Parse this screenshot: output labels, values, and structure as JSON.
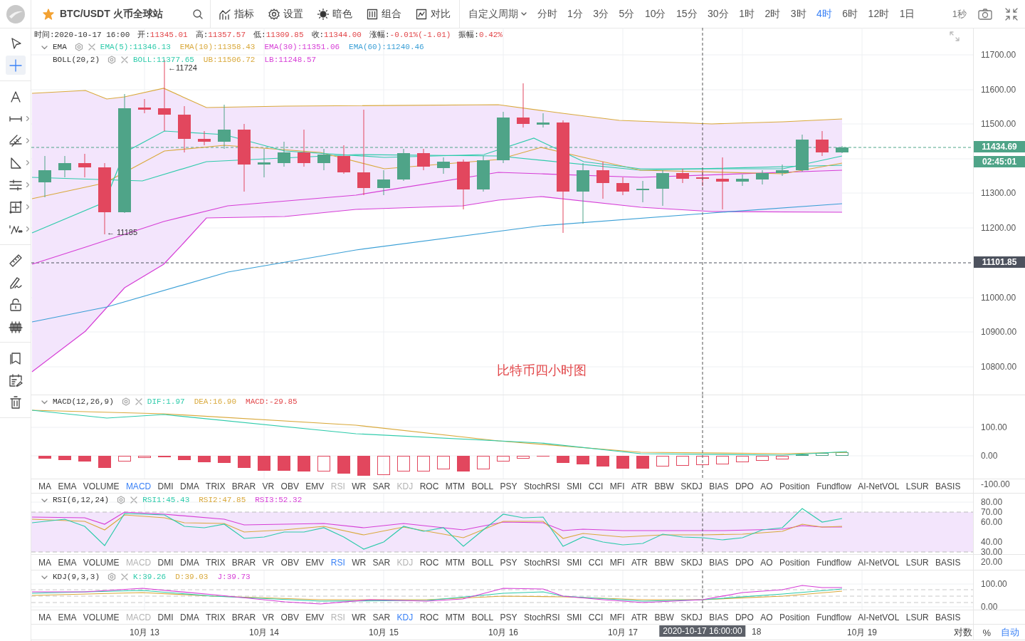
{
  "top_bar": {
    "symbol": "BTC/USDT 火币全球站",
    "favorite": true,
    "menus": [
      {
        "kind": "indicators",
        "label": "指标"
      },
      {
        "kind": "settings",
        "label": "设置"
      },
      {
        "kind": "theme",
        "label": "暗色"
      },
      {
        "kind": "layout",
        "label": "组合"
      },
      {
        "kind": "compare",
        "label": "对比"
      }
    ],
    "custom_period": "自定义周期",
    "periods": [
      {
        "label": "分时",
        "selected": false
      },
      {
        "label": "1分",
        "selected": false
      },
      {
        "label": "3分",
        "selected": false
      },
      {
        "label": "5分",
        "selected": false
      },
      {
        "label": "10分",
        "selected": false
      },
      {
        "label": "15分",
        "selected": false
      },
      {
        "label": "30分",
        "selected": false
      },
      {
        "label": "1时",
        "selected": false
      },
      {
        "label": "2时",
        "selected": false
      },
      {
        "label": "3时",
        "selected": false
      },
      {
        "label": "4时",
        "selected": true
      },
      {
        "label": "6时",
        "selected": false
      },
      {
        "label": "12时",
        "selected": false
      },
      {
        "label": "1日",
        "selected": false
      }
    ],
    "refresh": "1秒"
  },
  "drawing_tools": [
    [
      {
        "kind": "cursor",
        "selected": false,
        "submenu": false
      },
      {
        "kind": "crosshair",
        "selected": true,
        "submenu": false
      }
    ],
    [
      {
        "kind": "text",
        "selected": false,
        "submenu": false
      },
      {
        "kind": "segment",
        "selected": false,
        "submenu": true
      },
      {
        "kind": "channel",
        "selected": false,
        "submenu": true
      },
      {
        "kind": "triangle",
        "selected": false,
        "submenu": true
      },
      {
        "kind": "levels",
        "selected": false,
        "submenu": true
      },
      {
        "kind": "frame",
        "selected": false,
        "submenu": true
      },
      {
        "kind": "wave",
        "selected": false,
        "submenu": true
      }
    ],
    [
      {
        "kind": "ruler",
        "selected": false,
        "submenu": false
      },
      {
        "kind": "pen",
        "selected": false,
        "submenu": false
      },
      {
        "kind": "lock",
        "selected": false,
        "submenu": false
      },
      {
        "kind": "candles",
        "selected": false,
        "submenu": false
      }
    ],
    [
      {
        "kind": "bookmark",
        "selected": false,
        "submenu": false
      },
      {
        "kind": "calendar",
        "selected": false,
        "submenu": false
      },
      {
        "kind": "trash",
        "selected": false,
        "submenu": false
      }
    ]
  ],
  "main_pane": {
    "info": [
      {
        "label": "时间:",
        "value": "2020-10-17 16:00"
      },
      {
        "label": "开:",
        "value": "11345.01",
        "color": "#e2474a"
      },
      {
        "label": "高:",
        "value": "11357.57",
        "color": "#e2474a"
      },
      {
        "label": "低:",
        "value": "11309.85",
        "color": "#e2474a"
      },
      {
        "label": "收:",
        "value": "11344.00",
        "color": "#e2474a"
      },
      {
        "label": "涨幅:",
        "value": "-0.01%(-1.01)",
        "color": "#e2474a"
      },
      {
        "label": "振幅:",
        "value": "0.42%",
        "color": "#e2474a"
      }
    ],
    "legends": [
      {
        "name": "EMA",
        "expanded": true,
        "values": [
          {
            "text": "EMA(5):11346.13",
            "color": "#2ecbab"
          },
          {
            "text": "EMA(10):11358.43",
            "color": "#d9a93c"
          },
          {
            "text": "EMA(30):11351.06",
            "color": "#d63ed6"
          },
          {
            "text": "EMA(60):11240.46",
            "color": "#3a9fd6"
          }
        ]
      },
      {
        "name": "BOLL(20,2)",
        "values": [
          {
            "text": "BOLL:11377.65",
            "color": "#2ecbab"
          },
          {
            "text": "UB:11506.72",
            "color": "#d9a93c"
          },
          {
            "text": "LB:11248.57",
            "color": "#d63ed6"
          }
        ]
      }
    ],
    "high_marker": "←11724",
    "low_marker": "← 11185",
    "note": "比特币四小时图",
    "axis_labels": [
      "11700.00",
      "11600.00",
      "11500.00",
      "11300.00",
      "11200.00",
      "11000.00",
      "10900.00",
      "10800.00"
    ],
    "price_labels": [
      {
        "text": "11434.69",
        "color": "#4fa488"
      },
      {
        "text": "02:45:01",
        "color": "#4fa488"
      },
      {
        "text": "11101.85",
        "color": "#4d525e"
      }
    ]
  },
  "macd_pane": {
    "legend": {
      "name": "MACD(12,26,9)",
      "expanded": true,
      "values": [
        {
          "text": "DIF:1.97",
          "color": "#2ecbab"
        },
        {
          "text": "DEA:16.90",
          "color": "#d9a93c"
        },
        {
          "text": "MACD:-29.85",
          "color": "#e2474a"
        }
      ]
    },
    "axis_labels": [
      "100.00",
      "0.00",
      "-100.00"
    ]
  },
  "rsi_pane": {
    "legend": {
      "name": "RSI(6,12,24)",
      "expanded": true,
      "values": [
        {
          "text": "RSI1:45.43",
          "color": "#2ecbab"
        },
        {
          "text": "RSI2:47.85",
          "color": "#d9a93c"
        },
        {
          "text": "RSI3:52.32",
          "color": "#d63ed6"
        }
      ]
    },
    "axis_labels": [
      "80.00",
      "70.00",
      "60.00",
      "40.00",
      "30.00",
      "20.00"
    ]
  },
  "kdj_pane": {
    "legend": {
      "name": "KDJ(9,3,3)",
      "expanded": true,
      "values": [
        {
          "text": "K:39.26",
          "color": "#2ecbab"
        },
        {
          "text": "D:39.03",
          "color": "#d9a93c"
        },
        {
          "text": "J:39.73",
          "color": "#d63ed6"
        }
      ]
    },
    "axis_labels": [
      "100.00",
      "0.00"
    ]
  },
  "indicator_tab_rows": [
    [
      {
        "label": "MA",
        "selected": false,
        "disabled": false
      },
      {
        "label": "EMA",
        "selected": false,
        "disabled": false
      },
      {
        "label": "VOLUME",
        "selected": false,
        "disabled": false
      },
      {
        "label": "MACD",
        "selected": true,
        "disabled": false
      },
      {
        "label": "DMI",
        "selected": false,
        "disabled": false
      },
      {
        "label": "DMA",
        "selected": false,
        "disabled": false
      },
      {
        "label": "TRIX",
        "selected": false,
        "disabled": false
      },
      {
        "label": "BRAR",
        "selected": false,
        "disabled": false
      },
      {
        "label": "VR",
        "selected": false,
        "disabled": false
      },
      {
        "label": "OBV",
        "selected": false,
        "disabled": false
      },
      {
        "label": "EMV",
        "selected": false,
        "disabled": false
      },
      {
        "label": "RSI",
        "selected": false,
        "disabled": true
      },
      {
        "label": "WR",
        "selected": false,
        "disabled": false
      },
      {
        "label": "SAR",
        "selected": false,
        "disabled": false
      },
      {
        "label": "KDJ",
        "selected": false,
        "disabled": true
      },
      {
        "label": "ROC",
        "selected": false,
        "disabled": false
      },
      {
        "label": "MTM",
        "selected": false,
        "disabled": false
      },
      {
        "label": "BOLL",
        "selected": false,
        "disabled": false
      },
      {
        "label": "PSY",
        "selected": false,
        "disabled": false
      },
      {
        "label": "StochRSI",
        "selected": false,
        "disabled": false
      },
      {
        "label": "SMI",
        "selected": false,
        "disabled": false
      },
      {
        "label": "CCI",
        "selected": false,
        "disabled": false
      },
      {
        "label": "MFI",
        "selected": false,
        "disabled": false
      },
      {
        "label": "ATR",
        "selected": false,
        "disabled": false
      },
      {
        "label": "BBW",
        "selected": false,
        "disabled": false
      },
      {
        "label": "SKDJ",
        "selected": false,
        "disabled": false
      },
      {
        "label": "BIAS",
        "selected": false,
        "disabled": false
      },
      {
        "label": "DPO",
        "selected": false,
        "disabled": false
      },
      {
        "label": "AO",
        "selected": false,
        "disabled": false
      },
      {
        "label": "Position",
        "selected": false,
        "disabled": false
      },
      {
        "label": "Fundflow",
        "selected": false,
        "disabled": false
      },
      {
        "label": "AI-NetVOL",
        "selected": false,
        "disabled": false
      },
      {
        "label": "LSUR",
        "selected": false,
        "disabled": false
      },
      {
        "label": "BASIS",
        "selected": false,
        "disabled": false
      }
    ],
    [
      {
        "label": "MA",
        "selected": false,
        "disabled": false
      },
      {
        "label": "EMA",
        "selected": false,
        "disabled": false
      },
      {
        "label": "VOLUME",
        "selected": false,
        "disabled": false
      },
      {
        "label": "MACD",
        "selected": false,
        "disabled": true
      },
      {
        "label": "DMI",
        "selected": false,
        "disabled": false
      },
      {
        "label": "DMA",
        "selected": false,
        "disabled": false
      },
      {
        "label": "TRIX",
        "selected": false,
        "disabled": false
      },
      {
        "label": "BRAR",
        "selected": false,
        "disabled": false
      },
      {
        "label": "VR",
        "selected": false,
        "disabled": false
      },
      {
        "label": "OBV",
        "selected": false,
        "disabled": false
      },
      {
        "label": "EMV",
        "selected": false,
        "disabled": false
      },
      {
        "label": "RSI",
        "selected": true,
        "disabled": false
      },
      {
        "label": "WR",
        "selected": false,
        "disabled": false
      },
      {
        "label": "SAR",
        "selected": false,
        "disabled": false
      },
      {
        "label": "KDJ",
        "selected": false,
        "disabled": true
      },
      {
        "label": "ROC",
        "selected": false,
        "disabled": false
      },
      {
        "label": "MTM",
        "selected": false,
        "disabled": false
      },
      {
        "label": "BOLL",
        "selected": false,
        "disabled": false
      },
      {
        "label": "PSY",
        "selected": false,
        "disabled": false
      },
      {
        "label": "StochRSI",
        "selected": false,
        "disabled": false
      },
      {
        "label": "SMI",
        "selected": false,
        "disabled": false
      },
      {
        "label": "CCI",
        "selected": false,
        "disabled": false
      },
      {
        "label": "MFI",
        "selected": false,
        "disabled": false
      },
      {
        "label": "ATR",
        "selected": false,
        "disabled": false
      },
      {
        "label": "BBW",
        "selected": false,
        "disabled": false
      },
      {
        "label": "SKDJ",
        "selected": false,
        "disabled": false
      },
      {
        "label": "BIAS",
        "selected": false,
        "disabled": false
      },
      {
        "label": "DPO",
        "selected": false,
        "disabled": false
      },
      {
        "label": "AO",
        "selected": false,
        "disabled": false
      },
      {
        "label": "Position",
        "selected": false,
        "disabled": false
      },
      {
        "label": "Fundflow",
        "selected": false,
        "disabled": false
      },
      {
        "label": "AI-NetVOL",
        "selected": false,
        "disabled": false
      },
      {
        "label": "LSUR",
        "selected": false,
        "disabled": false
      },
      {
        "label": "BASIS",
        "selected": false,
        "disabled": false
      }
    ],
    [
      {
        "label": "MA",
        "selected": false,
        "disabled": false
      },
      {
        "label": "EMA",
        "selected": false,
        "disabled": false
      },
      {
        "label": "VOLUME",
        "selected": false,
        "disabled": false
      },
      {
        "label": "MACD",
        "selected": false,
        "disabled": true
      },
      {
        "label": "DMI",
        "selected": false,
        "disabled": false
      },
      {
        "label": "DMA",
        "selected": false,
        "disabled": false
      },
      {
        "label": "TRIX",
        "selected": false,
        "disabled": false
      },
      {
        "label": "BRAR",
        "selected": false,
        "disabled": false
      },
      {
        "label": "VR",
        "selected": false,
        "disabled": false
      },
      {
        "label": "OBV",
        "selected": false,
        "disabled": false
      },
      {
        "label": "EMV",
        "selected": false,
        "disabled": false
      },
      {
        "label": "RSI",
        "selected": false,
        "disabled": true
      },
      {
        "label": "WR",
        "selected": false,
        "disabled": false
      },
      {
        "label": "SAR",
        "selected": false,
        "disabled": false
      },
      {
        "label": "KDJ",
        "selected": true,
        "disabled": false
      },
      {
        "label": "ROC",
        "selected": false,
        "disabled": false
      },
      {
        "label": "MTM",
        "selected": false,
        "disabled": false
      },
      {
        "label": "BOLL",
        "selected": false,
        "disabled": false
      },
      {
        "label": "PSY",
        "selected": false,
        "disabled": false
      },
      {
        "label": "StochRSI",
        "selected": false,
        "disabled": false
      },
      {
        "label": "SMI",
        "selected": false,
        "disabled": false
      },
      {
        "label": "CCI",
        "selected": false,
        "disabled": false
      },
      {
        "label": "MFI",
        "selected": false,
        "disabled": false
      },
      {
        "label": "ATR",
        "selected": false,
        "disabled": false
      },
      {
        "label": "BBW",
        "selected": false,
        "disabled": false
      },
      {
        "label": "SKDJ",
        "selected": false,
        "disabled": false
      },
      {
        "label": "BIAS",
        "selected": false,
        "disabled": false
      },
      {
        "label": "DPO",
        "selected": false,
        "disabled": false
      },
      {
        "label": "AO",
        "selected": false,
        "disabled": false
      },
      {
        "label": "Position",
        "selected": false,
        "disabled": false
      },
      {
        "label": "Fundflow",
        "selected": false,
        "disabled": false
      },
      {
        "label": "AI-NetVOL",
        "selected": false,
        "disabled": false
      },
      {
        "label": "LSUR",
        "selected": false,
        "disabled": false
      },
      {
        "label": "BASIS",
        "selected": false,
        "disabled": false
      }
    ]
  ],
  "time_axis": {
    "labels": [
      "10月 13",
      "10月 14",
      "10月 15",
      "10月 16",
      "10月 17",
      "18",
      "10月 19"
    ],
    "crosshair_time": "2020-10-17 16:00:00"
  },
  "scale_options": [
    {
      "label": "对数",
      "selected": false
    },
    {
      "label": "%",
      "selected": false
    },
    {
      "label": "自动",
      "selected": true
    }
  ]
}
